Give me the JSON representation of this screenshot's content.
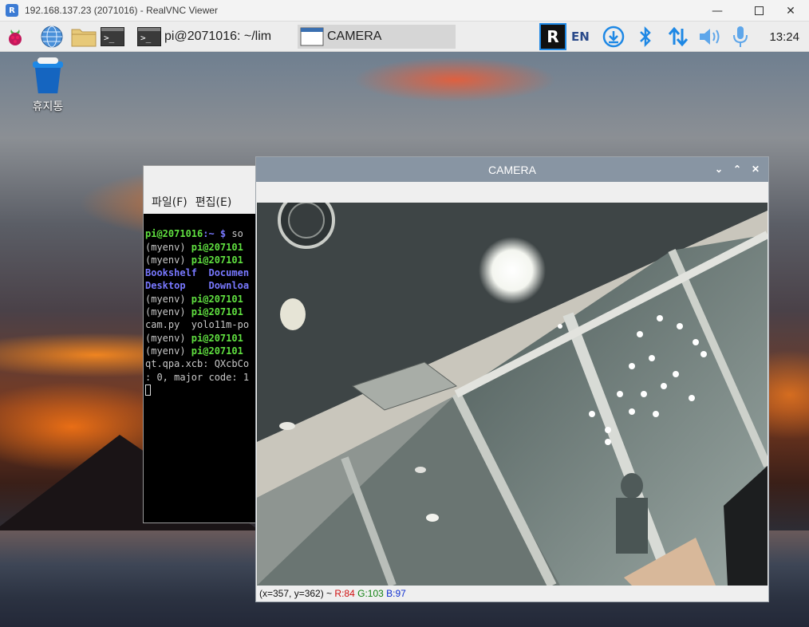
{
  "vnc": {
    "title": "192.168.137.23 (2071016) - RealVNC Viewer",
    "logo": "R",
    "controls": [
      "minimize-icon",
      "maximize-icon",
      "close-icon"
    ]
  },
  "panel": {
    "tasks": [
      {
        "label": "pi@2071016: ~/lim",
        "icon": "terminal-icon"
      },
      {
        "label": "CAMERA",
        "icon": "window-icon"
      }
    ],
    "terminal_glyph": ">_",
    "keyboard_indicator": "EN",
    "clock": "13:24",
    "tray_icons": [
      "realvnc-icon",
      "keyboard-layout-icon",
      "update-download-icon",
      "bluetooth-icon",
      "network-icon",
      "volume-icon",
      "microphone-icon"
    ]
  },
  "desktop": {
    "trash_label": "휴지통"
  },
  "terminal": {
    "menu": [
      "파일(F)",
      "편집(E)"
    ],
    "lines": [
      {
        "prompt": "pi@2071016",
        "path": ":~ $ ",
        "text": "so"
      },
      {
        "env": "(myenv) ",
        "prompt": "pi@207101"
      },
      {
        "env": "(myenv) ",
        "prompt": "pi@207101"
      },
      {
        "dirs": "Bookshelf  Documen"
      },
      {
        "dirs": "Desktop    Downloa"
      },
      {
        "env": "(myenv) ",
        "prompt": "pi@207101"
      },
      {
        "env": "(myenv) ",
        "prompt": "pi@207101"
      },
      {
        "text": "cam.py  yolo11m-po"
      },
      {
        "env": "(myenv) ",
        "prompt": "pi@207101"
      },
      {
        "env": "(myenv) ",
        "prompt": "pi@207101"
      },
      {
        "text": "qt.qpa.xcb: QXcbCo"
      },
      {
        "text": ": 0, major code: 1"
      }
    ]
  },
  "camera": {
    "title": "CAMERA",
    "controls": [
      "chevron-down-icon",
      "chevron-up-icon",
      "close-icon"
    ],
    "status": {
      "coords": "(x=357, y=362) ~ ",
      "r": "R:84",
      "g": "G:103",
      "b": "B:97"
    }
  }
}
